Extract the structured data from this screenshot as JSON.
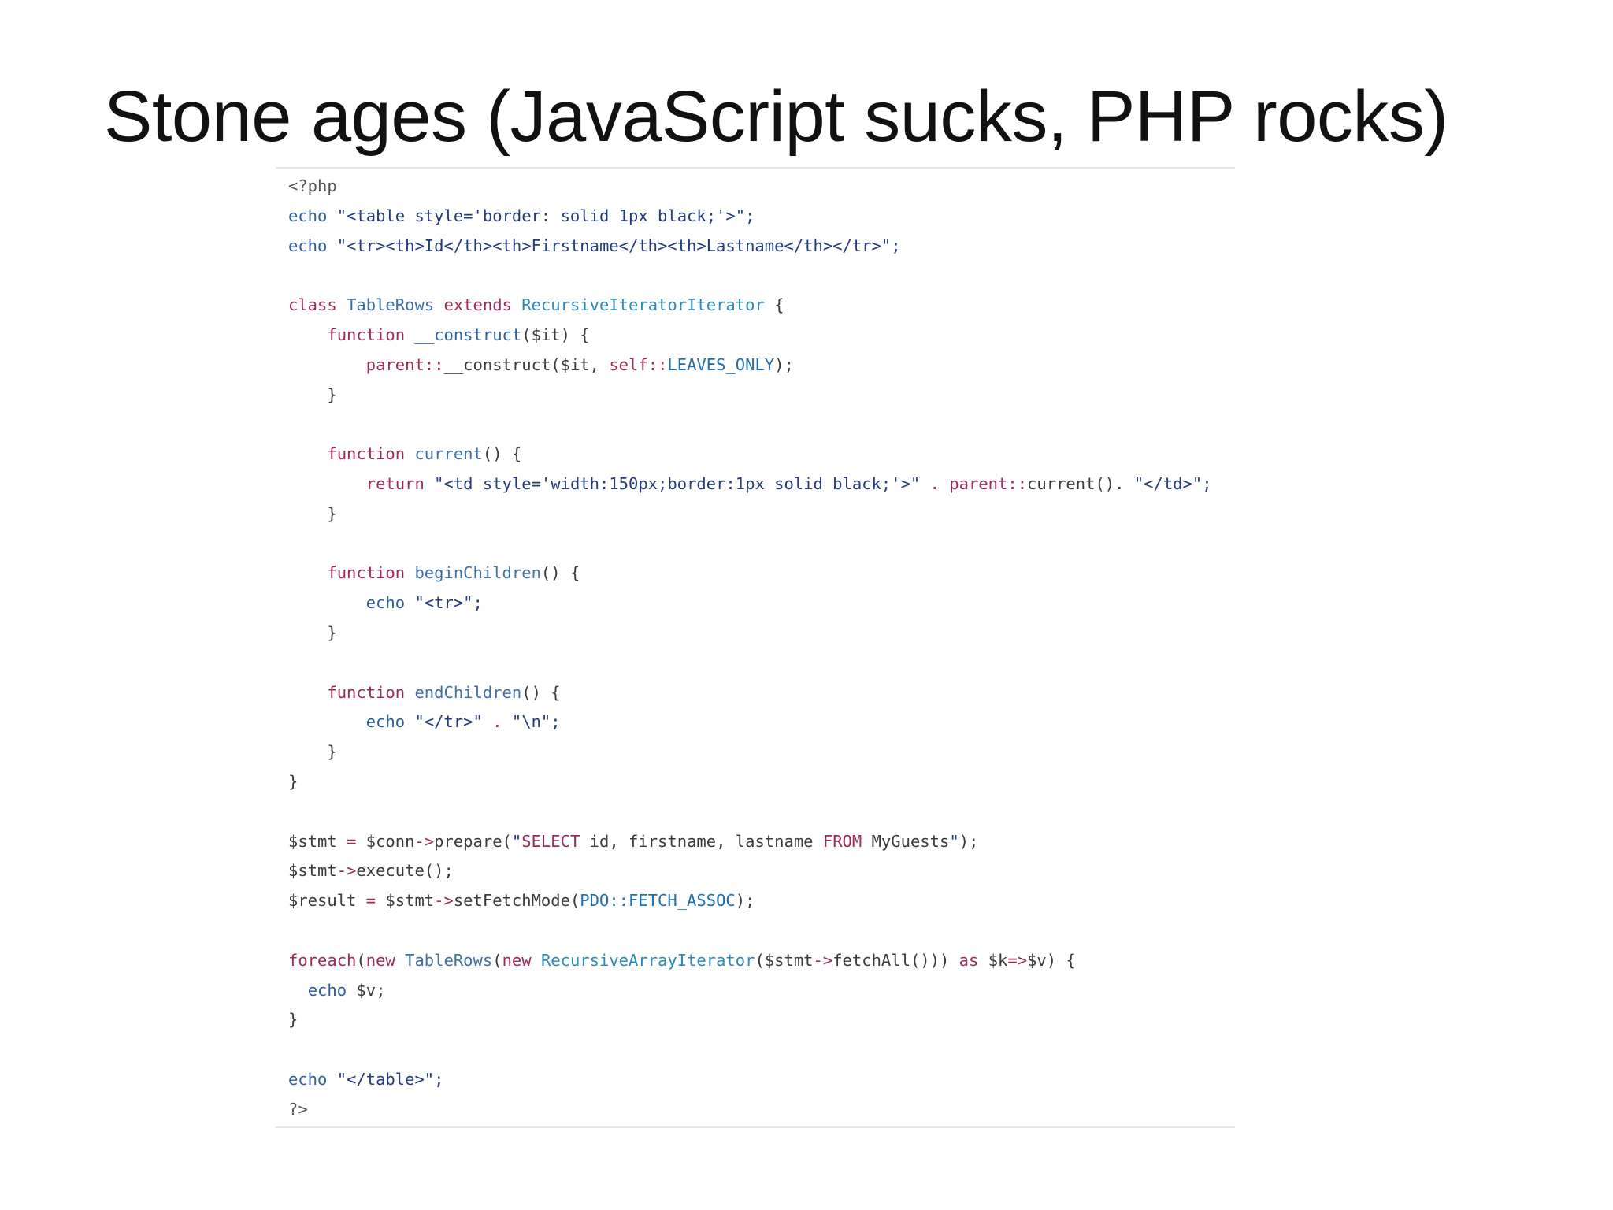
{
  "slide": {
    "title": "Stone ages (JavaScript sucks, PHP rocks)"
  },
  "code": {
    "language": "php",
    "lines": [
      [
        {
          "t": "<?php",
          "c": "meta"
        }
      ],
      [
        {
          "t": "echo",
          "c": "builtin"
        },
        {
          "t": " \"<table style='border: solid 1px black;'>\";",
          "c": "string"
        }
      ],
      [
        {
          "t": "echo",
          "c": "builtin"
        },
        {
          "t": " \"<tr><th>Id</th><th>Firstname</th><th>Lastname</th></tr>\";",
          "c": "string"
        }
      ],
      [],
      [
        {
          "t": "class",
          "c": "keyword"
        },
        {
          "t": " ",
          "c": "default"
        },
        {
          "t": "TableRows",
          "c": "func"
        },
        {
          "t": " ",
          "c": "default"
        },
        {
          "t": "extends",
          "c": "keyword"
        },
        {
          "t": " ",
          "c": "default"
        },
        {
          "t": "RecursiveIteratorIterator",
          "c": "type"
        },
        {
          "t": " {",
          "c": "default"
        }
      ],
      [
        {
          "t": "    ",
          "c": "default"
        },
        {
          "t": "function",
          "c": "keyword"
        },
        {
          "t": " ",
          "c": "default"
        },
        {
          "t": "__construct",
          "c": "builtin"
        },
        {
          "t": "($it) {",
          "c": "default"
        }
      ],
      [
        {
          "t": "        ",
          "c": "default"
        },
        {
          "t": "parent::",
          "c": "keyword"
        },
        {
          "t": "__construct($it, ",
          "c": "default"
        },
        {
          "t": "self::",
          "c": "keyword"
        },
        {
          "t": "LEAVES_ONLY",
          "c": "const"
        },
        {
          "t": ");",
          "c": "default"
        }
      ],
      [
        {
          "t": "    }",
          "c": "default"
        }
      ],
      [],
      [
        {
          "t": "    ",
          "c": "default"
        },
        {
          "t": "function",
          "c": "keyword"
        },
        {
          "t": " ",
          "c": "default"
        },
        {
          "t": "current",
          "c": "func"
        },
        {
          "t": "() {",
          "c": "default"
        }
      ],
      [
        {
          "t": "        ",
          "c": "default"
        },
        {
          "t": "return",
          "c": "keyword"
        },
        {
          "t": " \"<td style='width:150px;border:1px solid black;'>\"",
          "c": "string"
        },
        {
          "t": " . ",
          "c": "op"
        },
        {
          "t": "parent::",
          "c": "keyword"
        },
        {
          "t": "current(). ",
          "c": "default"
        },
        {
          "t": "\"</td>\";",
          "c": "string"
        }
      ],
      [
        {
          "t": "    }",
          "c": "default"
        }
      ],
      [],
      [
        {
          "t": "    ",
          "c": "default"
        },
        {
          "t": "function",
          "c": "keyword"
        },
        {
          "t": " ",
          "c": "default"
        },
        {
          "t": "beginChildren",
          "c": "func"
        },
        {
          "t": "() {",
          "c": "default"
        }
      ],
      [
        {
          "t": "        ",
          "c": "default"
        },
        {
          "t": "echo",
          "c": "builtin"
        },
        {
          "t": " \"<tr>\";",
          "c": "string"
        }
      ],
      [
        {
          "t": "    }",
          "c": "default"
        }
      ],
      [],
      [
        {
          "t": "    ",
          "c": "default"
        },
        {
          "t": "function",
          "c": "keyword"
        },
        {
          "t": " ",
          "c": "default"
        },
        {
          "t": "endChildren",
          "c": "func"
        },
        {
          "t": "() {",
          "c": "default"
        }
      ],
      [
        {
          "t": "        ",
          "c": "default"
        },
        {
          "t": "echo",
          "c": "builtin"
        },
        {
          "t": " \"</tr>\"",
          "c": "string"
        },
        {
          "t": " . ",
          "c": "op"
        },
        {
          "t": "\"\\n\";",
          "c": "string"
        }
      ],
      [
        {
          "t": "    }",
          "c": "default"
        }
      ],
      [
        {
          "t": "}",
          "c": "default"
        }
      ],
      [],
      [
        {
          "t": "$stmt ",
          "c": "default"
        },
        {
          "t": "=",
          "c": "op"
        },
        {
          "t": " $conn",
          "c": "default"
        },
        {
          "t": "->",
          "c": "op"
        },
        {
          "t": "prepare(",
          "c": "default"
        },
        {
          "t": "\"",
          "c": "string"
        },
        {
          "t": "SELECT",
          "c": "keyword"
        },
        {
          "t": " id, firstname, lastname ",
          "c": "default"
        },
        {
          "t": "FROM",
          "c": "keyword"
        },
        {
          "t": " MyGuests",
          "c": "default"
        },
        {
          "t": "\"",
          "c": "string"
        },
        {
          "t": ");",
          "c": "default"
        }
      ],
      [
        {
          "t": "$stmt",
          "c": "default"
        },
        {
          "t": "->",
          "c": "op"
        },
        {
          "t": "execute();",
          "c": "default"
        }
      ],
      [
        {
          "t": "$result ",
          "c": "default"
        },
        {
          "t": "=",
          "c": "op"
        },
        {
          "t": " $stmt",
          "c": "default"
        },
        {
          "t": "->",
          "c": "op"
        },
        {
          "t": "setFetchMode(",
          "c": "default"
        },
        {
          "t": "PDO::FETCH_ASSOC",
          "c": "const"
        },
        {
          "t": ");",
          "c": "default"
        }
      ],
      [],
      [
        {
          "t": "foreach",
          "c": "keyword"
        },
        {
          "t": "(",
          "c": "default"
        },
        {
          "t": "new",
          "c": "keyword"
        },
        {
          "t": " ",
          "c": "default"
        },
        {
          "t": "TableRows",
          "c": "func"
        },
        {
          "t": "(",
          "c": "default"
        },
        {
          "t": "new",
          "c": "keyword"
        },
        {
          "t": " ",
          "c": "default"
        },
        {
          "t": "RecursiveArrayIterator",
          "c": "type"
        },
        {
          "t": "($stmt",
          "c": "default"
        },
        {
          "t": "->",
          "c": "op"
        },
        {
          "t": "fetchAll())) ",
          "c": "default"
        },
        {
          "t": "as",
          "c": "keyword"
        },
        {
          "t": " $k",
          "c": "default"
        },
        {
          "t": "=>",
          "c": "op"
        },
        {
          "t": "$v) {",
          "c": "default"
        }
      ],
      [
        {
          "t": "  ",
          "c": "default"
        },
        {
          "t": "echo",
          "c": "builtin"
        },
        {
          "t": " $v;",
          "c": "default"
        }
      ],
      [
        {
          "t": "}",
          "c": "default"
        }
      ],
      [],
      [
        {
          "t": "echo",
          "c": "builtin"
        },
        {
          "t": " \"</table>\";",
          "c": "string"
        }
      ],
      [
        {
          "t": "?>",
          "c": "meta"
        }
      ]
    ]
  }
}
